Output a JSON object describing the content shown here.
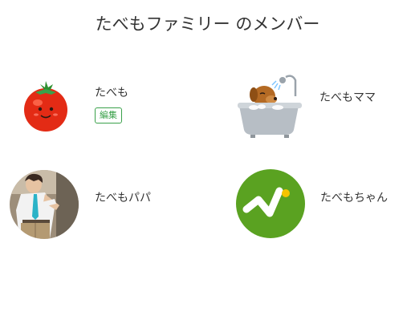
{
  "page": {
    "title": "たべもファミリー のメンバー"
  },
  "members": [
    {
      "name": "たべも",
      "avatar_icon": "tomato-character-icon",
      "edit_label": "編集"
    },
    {
      "name": "たべもママ",
      "avatar_icon": "dog-in-bathtub-icon"
    },
    {
      "name": "たべもパパ",
      "avatar_icon": "anime-man-photo"
    },
    {
      "name": "たべもちゃん",
      "avatar_icon": "green-circle-check-logo"
    }
  ],
  "colors": {
    "edit_accent": "#3aa14a",
    "logo_green": "#5aa221",
    "logo_dot": "#f5c400",
    "tomato_red": "#e32b15"
  }
}
